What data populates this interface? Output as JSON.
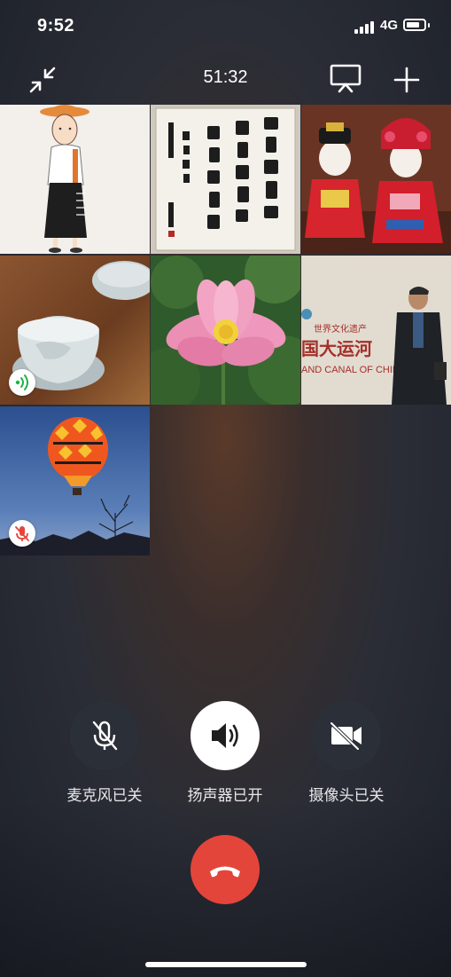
{
  "status_bar": {
    "time": "9:52",
    "network": "4G"
  },
  "call": {
    "duration": "51:32"
  },
  "tiles": [
    {
      "id": "avatar-cartoon-girl",
      "badge": null
    },
    {
      "id": "avatar-calligraphy",
      "badge": null
    },
    {
      "id": "avatar-opera-dolls",
      "badge": null
    },
    {
      "id": "avatar-porcelain-bowl",
      "badge": "speaking-icon"
    },
    {
      "id": "avatar-lotus-flower",
      "badge": null
    },
    {
      "id": "avatar-grand-canal-man",
      "badge": null,
      "sign_line1": "世界文化遗产",
      "sign_line2": "国大运河",
      "sign_line3": "AND CANAL OF CHINA"
    },
    {
      "id": "avatar-hot-air-balloon",
      "badge": "mic-muted-icon"
    }
  ],
  "controls": {
    "mic": {
      "label": "麦克风已关",
      "state": "off",
      "icon": "mic-off-icon"
    },
    "speaker": {
      "label": "扬声器已开",
      "state": "on",
      "icon": "speaker-icon"
    },
    "camera": {
      "label": "摄像头已关",
      "state": "off",
      "icon": "camera-off-icon"
    },
    "hangup": {
      "icon": "hangup-icon",
      "color": "#e4453b"
    }
  }
}
